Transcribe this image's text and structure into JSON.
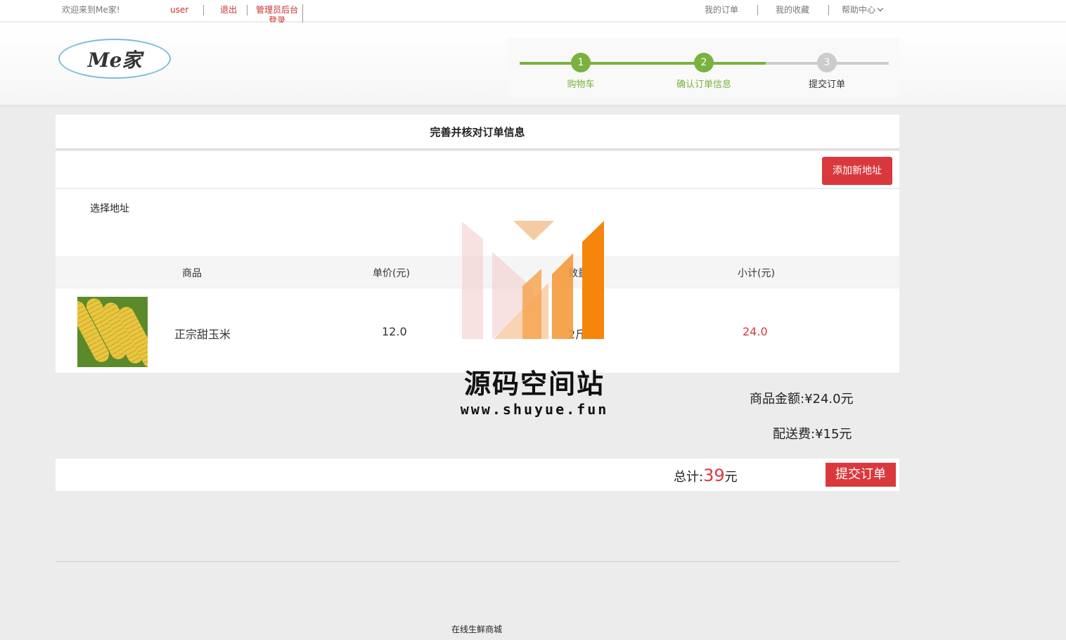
{
  "topbar": {
    "welcome": "欢迎来到Me家!",
    "user": "user",
    "logout": "退出",
    "admin_login": "管理员后台登录",
    "my_orders": "我的订单",
    "my_favorites": "我的收藏",
    "help_center": "帮助中心"
  },
  "header": {
    "logo_text": "Me家",
    "steps": [
      {
        "number": "1",
        "label": "购物车",
        "state": "done"
      },
      {
        "number": "2",
        "label": "确认订单信息",
        "state": "active"
      },
      {
        "number": "3",
        "label": "提交订单",
        "state": "pending"
      }
    ]
  },
  "colors": {
    "accent_green": "#7ab13f",
    "accent_red": "#d9393d",
    "inactive_gray": "#cccccc"
  },
  "main": {
    "title": "完善并核对订单信息",
    "add_address_label": "添加新地址",
    "select_address_label": "选择地址",
    "table": {
      "headers": [
        "商品",
        "单价(元)",
        "数量",
        "小计(元)"
      ],
      "rows": [
        {
          "name": "正宗甜玉米",
          "price": "12.0",
          "quantity": "2斤",
          "subtotal": "24.0"
        }
      ]
    },
    "summary": {
      "goods_amount_label": "商品金额:",
      "goods_amount_value": "¥24.0元",
      "shipping_label": "配送费:",
      "shipping_value": "¥15元"
    },
    "total": {
      "label": "总计:",
      "value": "39",
      "unit": "元",
      "submit_label": "提交订单"
    }
  },
  "watermark": {
    "title": "源码空间站",
    "url": "www.shuyue.fun"
  },
  "footer": {
    "text": "在线生鲜商城"
  }
}
